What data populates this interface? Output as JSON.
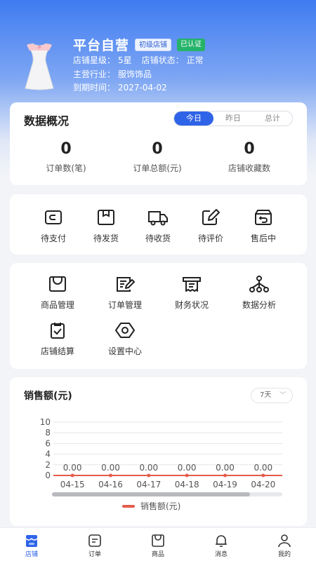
{
  "shop": {
    "name": "平台自营",
    "level_badge": "初级店铺",
    "verified_badge": "已认证",
    "star_label": "店铺星级：",
    "star_value": "5星",
    "status_label": "店铺状态：",
    "status_value": "正常",
    "industry_label": "主营行业：",
    "industry_value": "服饰饰品",
    "expire_label": "到期时间：",
    "expire_value": "2027-04-02"
  },
  "overview": {
    "title": "数据概况",
    "tabs": [
      "今日",
      "昨日",
      "总计"
    ],
    "active_tab": 0,
    "stats": [
      {
        "value": "0",
        "label": "订单数(笔)"
      },
      {
        "value": "0",
        "label": "订单总额(元)"
      },
      {
        "value": "0",
        "label": "店铺收藏数"
      }
    ]
  },
  "orders": [
    {
      "label": "待支付",
      "icon": "wallet-icon"
    },
    {
      "label": "待发货",
      "icon": "package-icon"
    },
    {
      "label": "待收货",
      "icon": "truck-icon"
    },
    {
      "label": "待评价",
      "icon": "edit-icon"
    },
    {
      "label": "售后中",
      "icon": "return-box-icon"
    }
  ],
  "management": [
    {
      "label": "商品管理",
      "icon": "shopping-bag-icon"
    },
    {
      "label": "订单管理",
      "icon": "order-list-icon"
    },
    {
      "label": "财务状况",
      "icon": "receipt-icon"
    },
    {
      "label": "数据分析",
      "icon": "hierarchy-icon"
    },
    {
      "label": "店铺结算",
      "icon": "clipboard-check-icon"
    },
    {
      "label": "设置中心",
      "icon": "hexagon-settings-icon"
    }
  ],
  "sales": {
    "title": "销售额(元)",
    "range": "7天"
  },
  "chart_data": {
    "type": "line",
    "title": "销售额(元)",
    "categories": [
      "04-15",
      "04-16",
      "04-17",
      "04-18",
      "04-19",
      "04-20"
    ],
    "series": [
      {
        "name": "销售额(元)",
        "values": [
          0.0,
          0.0,
          0.0,
          0.0,
          0.0,
          0.0
        ],
        "color": "#e45b4b"
      }
    ],
    "data_labels": [
      "0.00",
      "0.00",
      "0.00",
      "0.00",
      "0.00",
      "0.00"
    ],
    "yticks": [
      "0",
      "2",
      "4",
      "6",
      "8",
      "10"
    ],
    "ylim": [
      0,
      10
    ],
    "grid": true,
    "legend": "bottom"
  },
  "tabbar": [
    {
      "label": "店铺",
      "icon": "shop-icon",
      "active": true
    },
    {
      "label": "订单",
      "icon": "order-icon",
      "active": false
    },
    {
      "label": "商品",
      "icon": "bag-icon",
      "active": false
    },
    {
      "label": "消息",
      "icon": "bell-icon",
      "active": false
    },
    {
      "label": "我的",
      "icon": "user-icon",
      "active": false
    }
  ],
  "colors": {
    "primary": "#2f63e8",
    "verified": "#25b36a",
    "series": "#e45b4b"
  }
}
